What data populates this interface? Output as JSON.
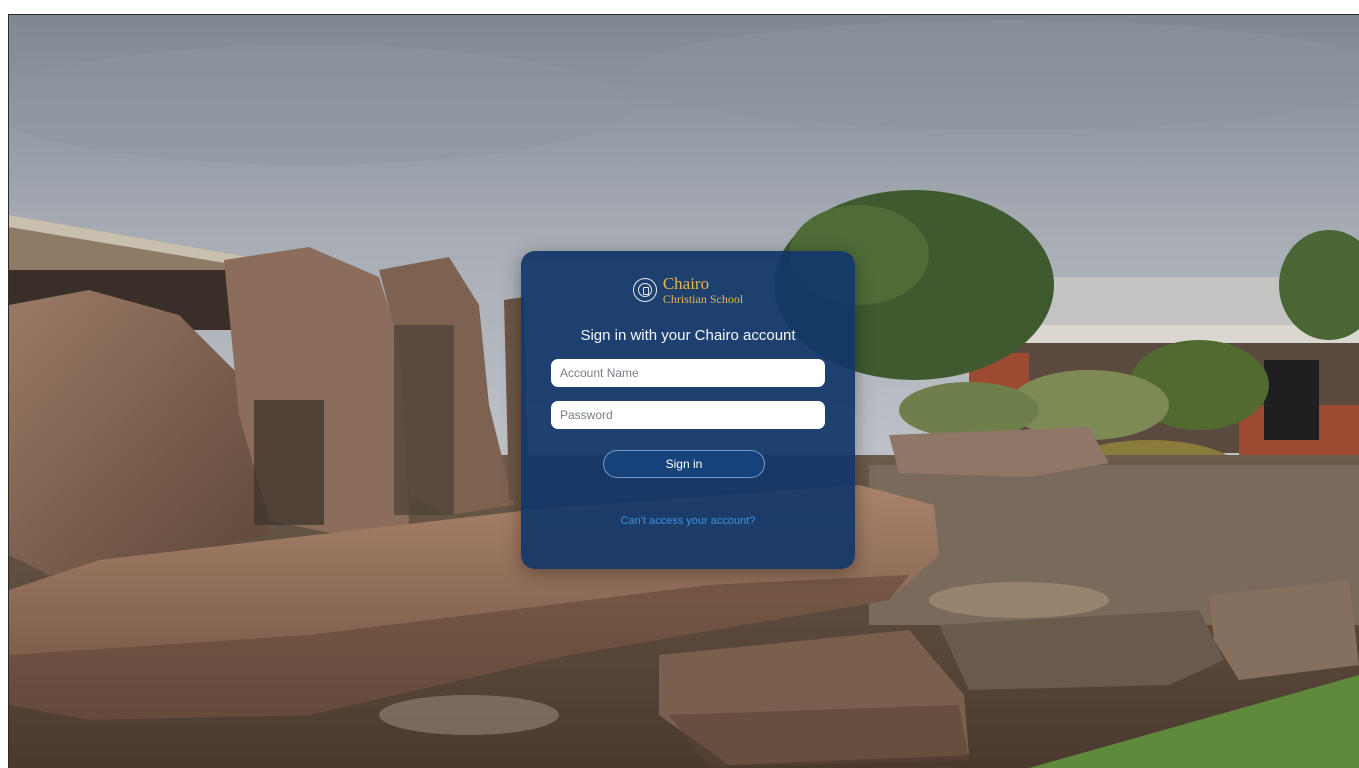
{
  "brand": {
    "name": "Chairo",
    "subtitle": "Christian School",
    "accent_color": "#e9b44c",
    "crest_icon": "school-crest-icon"
  },
  "login": {
    "heading": "Sign in with your Chairo account",
    "account_placeholder": "Account Name",
    "account_value": "",
    "password_placeholder": "Password",
    "password_value": "",
    "signin_label": "Sign in",
    "help_link": "Can't access your account?",
    "card_color": "#123769",
    "link_color": "#3d8fe0"
  },
  "background": {
    "scene": "school-courtyard-photo"
  }
}
